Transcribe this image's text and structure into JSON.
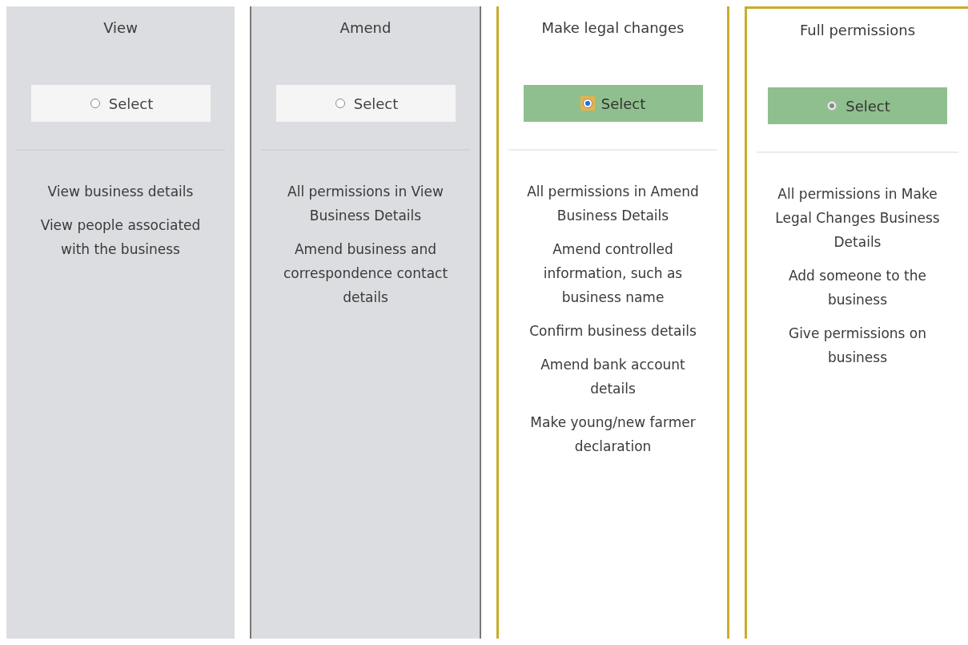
{
  "options": [
    {
      "title": "View",
      "selected": false,
      "radio": {
        "label": "Select",
        "checked": false,
        "focused": false,
        "disabled": false
      },
      "permissions": [
        "View business details",
        "View people associated with the business"
      ]
    },
    {
      "title": "Amend",
      "selected": false,
      "radio": {
        "label": "Select",
        "checked": false,
        "focused": false,
        "disabled": false
      },
      "permissions": [
        "All permissions in View Business Details",
        "Amend business and correspondence contact details"
      ]
    },
    {
      "title": "Make legal changes",
      "selected": true,
      "radio": {
        "label": "Select",
        "checked": true,
        "focused": true,
        "disabled": false
      },
      "permissions": [
        "All permissions in Amend Business Details",
        "Amend controlled information, such as business name",
        "Confirm business details",
        "Amend bank account details",
        "Make young/new farmer declaration"
      ]
    },
    {
      "title": "Full permissions",
      "selected": true,
      "radio": {
        "label": "Select",
        "checked": true,
        "focused": false,
        "disabled": true
      },
      "permissions": [
        "All permissions in Make Legal Changes Business Details",
        "Add someone to the business",
        "Give permissions on business"
      ]
    }
  ]
}
